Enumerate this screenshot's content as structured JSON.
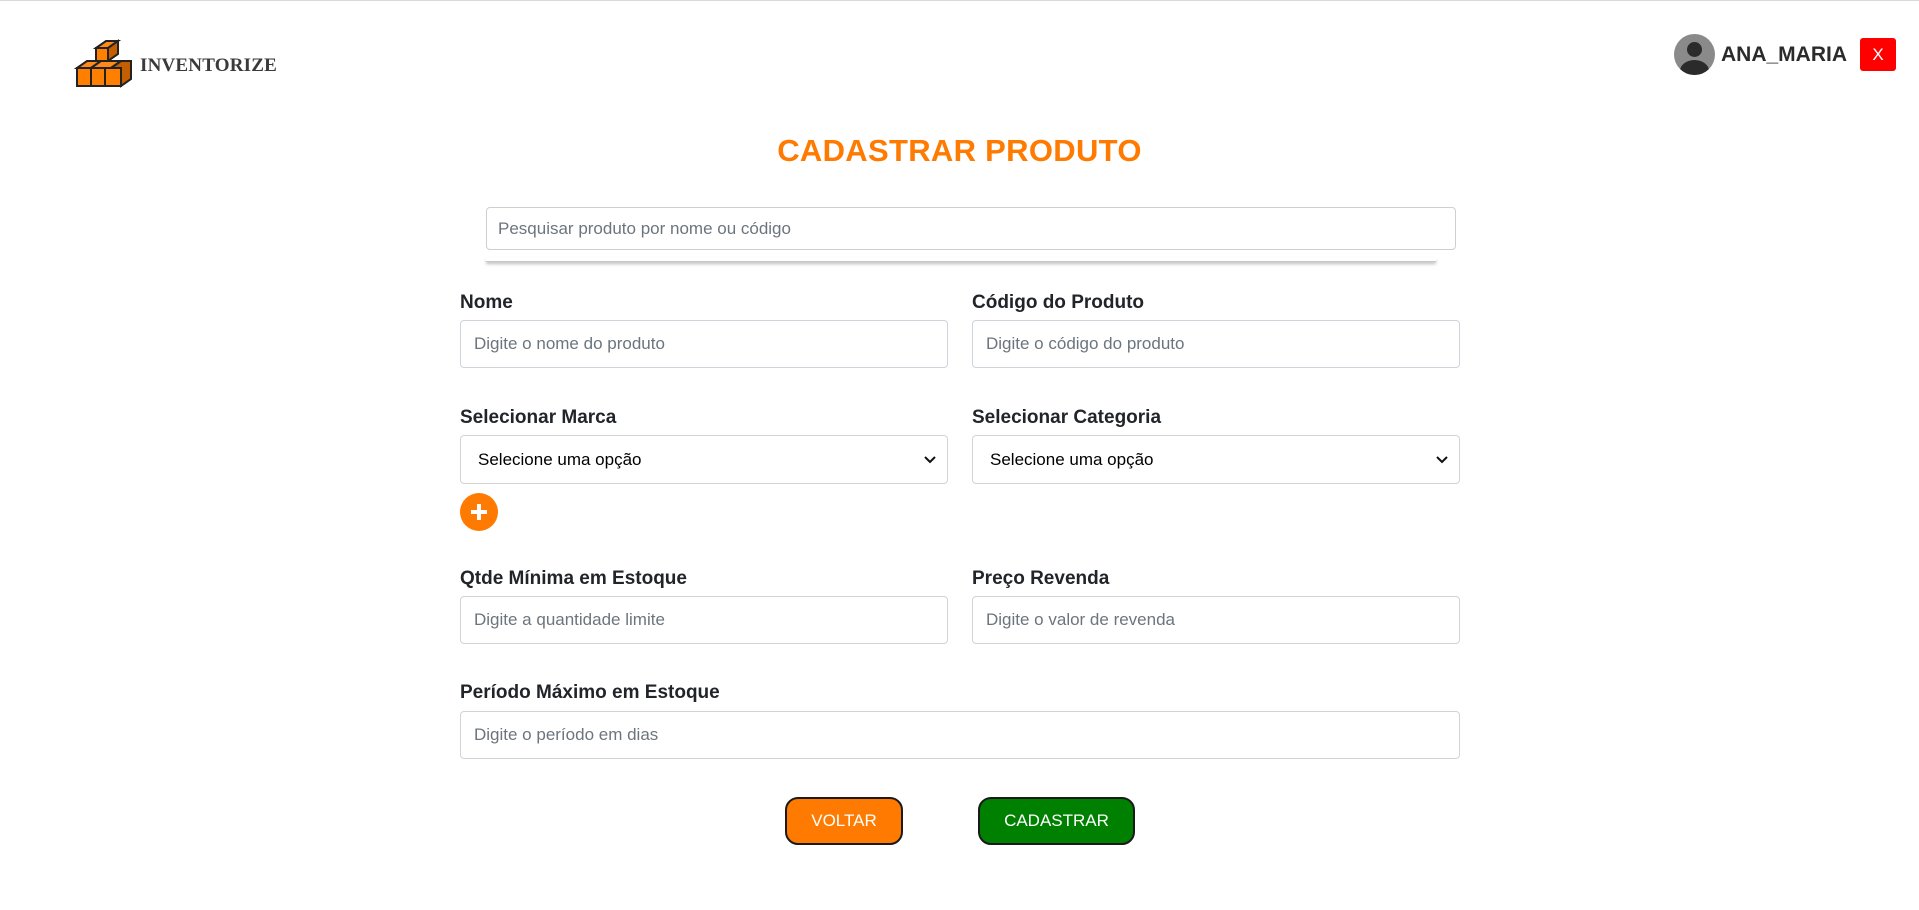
{
  "app": {
    "logo_text": "INVENTORIZE",
    "user_name": "ANA_MARIA",
    "close_label": "X"
  },
  "page": {
    "title": "CADASTRAR PRODUTO"
  },
  "search": {
    "placeholder": "Pesquisar produto por nome ou código"
  },
  "form": {
    "name": {
      "label": "Nome",
      "placeholder": "Digite o nome do produto"
    },
    "code": {
      "label": "Código do Produto",
      "placeholder": "Digite o código do produto"
    },
    "brand": {
      "label": "Selecionar Marca",
      "selected": "Selecione uma opção"
    },
    "category": {
      "label": "Selecionar Categoria",
      "selected": "Selecione uma opção"
    },
    "min_qty": {
      "label": "Qtde Mínima em Estoque",
      "placeholder": "Digite a quantidade limite"
    },
    "price": {
      "label": "Preço Revenda",
      "placeholder": "Digite o valor de revenda"
    },
    "period": {
      "label": "Período Máximo em Estoque",
      "placeholder": "Digite o período em dias"
    }
  },
  "actions": {
    "back_label": "VOLTAR",
    "submit_label": "CADASTRAR"
  },
  "icons": {
    "logo": "boxes-logo-icon",
    "avatar": "user-avatar-icon",
    "add": "plus-icon",
    "select_chevron": "chevron-down-icon"
  },
  "colors": {
    "accent": "#ff7a00",
    "submit": "#008000",
    "close": "#ff0000"
  }
}
